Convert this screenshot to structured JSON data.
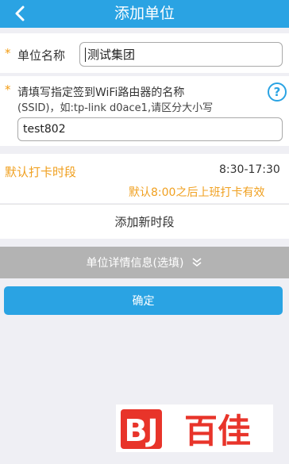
{
  "header": {
    "title": "添加单位",
    "back_icon": "chevron-left-icon"
  },
  "unit_name": {
    "label": "单位名称",
    "value": "测试集团",
    "required_mark": "*"
  },
  "wifi": {
    "label_line1": "请填写指定签到WiFi路由器的名称",
    "label_line2": "(SSID)，如:tp-link d0ace1,请区分大小写",
    "value": "test802",
    "required_mark": "*",
    "help_icon": "?"
  },
  "period": {
    "label": "默认打卡时段",
    "time": "8:30-17:30",
    "note": "默认8:00之后上班打卡有效"
  },
  "add_period_label": "添加新时段",
  "details_label": "单位详情信息(选填)",
  "confirm_label": "确定",
  "watermark": {
    "text": "百佳",
    "brand_color": "#e8342a"
  },
  "colors": {
    "primary": "#2aa3e3",
    "accent": "#f0a020",
    "disabled": "#b3b3b3"
  }
}
